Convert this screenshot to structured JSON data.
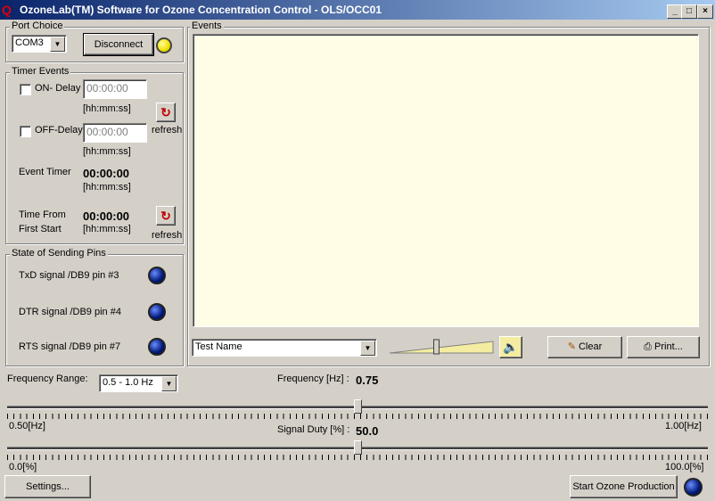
{
  "window": {
    "title": "OzoneLab(TM) Software for Ozone Concentration Control - OLS/OCC01",
    "icon_text": "Q"
  },
  "port": {
    "group_label": "Port Choice",
    "selected": "COM3",
    "disconnect_label": "Disconnect"
  },
  "timer": {
    "group_label": "Timer Events",
    "on_delay_label": "ON- Delay",
    "on_delay_value": "00:00:00",
    "format1": "[hh:mm:ss]",
    "off_delay_label": "OFF-Delay",
    "off_delay_value": "00:00:00",
    "format2": "[hh:mm:ss]",
    "refresh1": "refresh",
    "event_timer_label": "Event Timer",
    "event_timer_value": "00:00:00",
    "format3": "[hh:mm:ss]",
    "time_from_label1": "Time From",
    "time_from_label2": "First Start",
    "time_from_value": "00:00:00",
    "format4": "[hh:mm:ss]",
    "refresh2": "refresh"
  },
  "pins": {
    "group_label": "State of Sending Pins",
    "txd": "TxD signal  /DB9 pin #3",
    "dtr": "DTR signal /DB9 pin #4",
    "rts": "RTS signal /DB9 pin #7"
  },
  "events": {
    "group_label": "Events",
    "test_name": "Test Name",
    "volume_level": 0.45,
    "clear_label": "Clear",
    "print_label": "Print..."
  },
  "frequency": {
    "range_label": "Frequency Range:",
    "range_selected": "0.5 - 1.0 Hz",
    "freq_label": "Frequency [Hz] :",
    "freq_value": "0.75",
    "min_label": "0.50[Hz]",
    "max_label": "1.00[Hz]",
    "slider_fraction": 0.5
  },
  "duty": {
    "label": "Signal Duty [%] :",
    "value": "50.0",
    "min_label": "0.0[%]",
    "max_label": "100.0[%]",
    "slider_fraction": 0.5
  },
  "bottom": {
    "settings_label": "Settings...",
    "start_label": "Start Ozone Production"
  },
  "colors": {
    "events_bg": "#fffde6",
    "led_blue": "#0a1f8f",
    "led_yellow": "#f0e000"
  }
}
